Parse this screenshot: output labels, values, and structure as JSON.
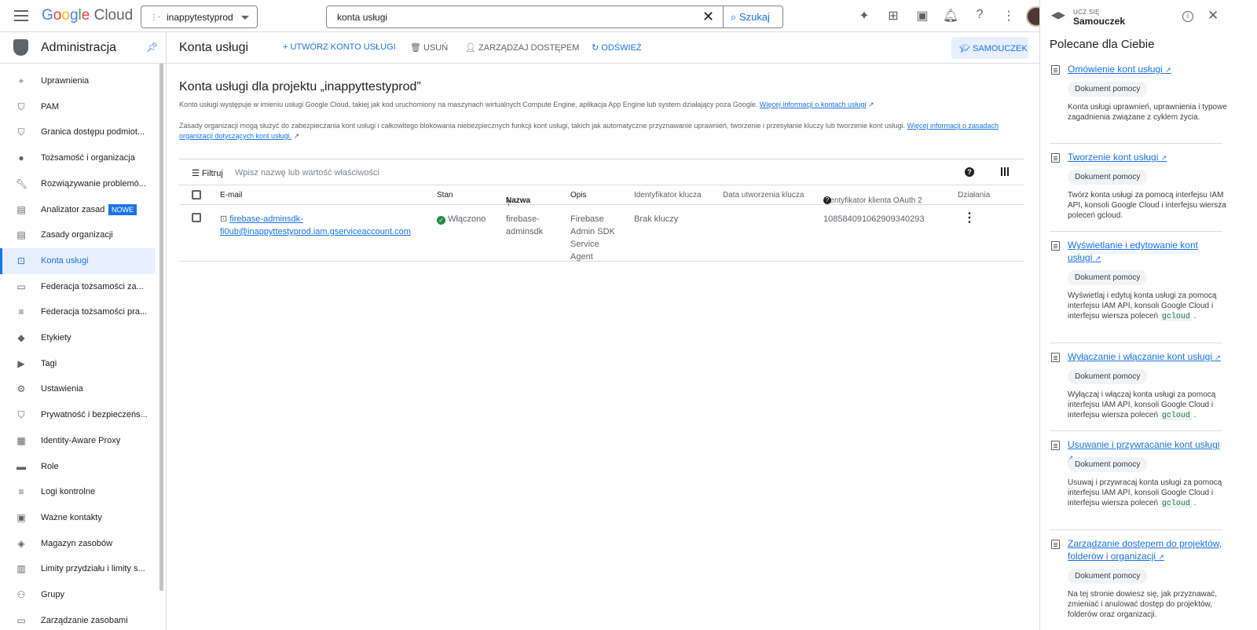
{
  "header": {
    "logo_google": "Google",
    "logo_cloud": "Cloud",
    "project": "inappytestyprod",
    "search_value": "konta usługi",
    "search_button": "Szukaj"
  },
  "nav": {
    "title": "Administracja",
    "items": [
      {
        "label": "Uprawnienia",
        "icon": "add-person-icon"
      },
      {
        "label": "PAM",
        "icon": "shield-icon"
      },
      {
        "label": "Granica dostępu podmiot...",
        "icon": "shield-lock-icon"
      },
      {
        "label": "Tożsamość i organizacja",
        "icon": "account-circle-icon"
      },
      {
        "label": "Rozwiązywanie problemó...",
        "icon": "wrench-icon"
      },
      {
        "label": "Analizator zasad",
        "icon": "policy-icon",
        "badge": "NOWE"
      },
      {
        "label": "Zasady organizacji",
        "icon": "list-alt-icon"
      },
      {
        "label": "Konta usługi",
        "icon": "service-account-icon",
        "active": true
      },
      {
        "label": "Federacja tożsamości za...",
        "icon": "id-card-icon"
      },
      {
        "label": "Federacja tożsamości pra...",
        "icon": "list-icon"
      },
      {
        "label": "Etykiety",
        "icon": "label-icon"
      },
      {
        "label": "Tagi",
        "icon": "tag-icon"
      },
      {
        "label": "Ustawienia",
        "icon": "gear-icon"
      },
      {
        "label": "Prywatność i bezpieczeńs...",
        "icon": "shield-icon"
      },
      {
        "label": "Identity-Aware Proxy",
        "icon": "iap-icon"
      },
      {
        "label": "Role",
        "icon": "hat-icon"
      },
      {
        "label": "Logi kontrolne",
        "icon": "lines-icon"
      },
      {
        "label": "Ważne kontakty",
        "icon": "contacts-icon"
      },
      {
        "label": "Magazyn zasobów",
        "icon": "diamond-icon"
      },
      {
        "label": "Limity przydziału i limity s...",
        "icon": "table-icon"
      },
      {
        "label": "Grupy",
        "icon": "group-icon"
      },
      {
        "label": "Zarządzanie zasobami",
        "icon": "folder-icon"
      }
    ]
  },
  "toolbar": {
    "title": "Konta usługi",
    "create": "UTWÓRZ KONTO USŁUGI",
    "delete": "USUŃ",
    "manage": "ZARZĄDZAJ DOSTĘPEM",
    "refresh": "ODŚWIEŻ",
    "tutorial": "SAMOUCZEK"
  },
  "main": {
    "heading": "Konta usługi dla projektu „inappyttestyprod”",
    "para1": "Konto usługi występuje w imieniu usługi Google Cloud, takiej jak kod uruchomiony na maszynach wirtualnych Compute Engine, aplikacja App Engine lub system działający poza Google.",
    "para1_link": "Więcej informacji o kontach usługi",
    "para2": "Zasady organizacji mogą służyć do zabezpieczania kont usługi i całkowitego blokowania niebezpiecznych funkcji kont usługi, takich jak automatyczne przyznawanie uprawnień, tworzenie i przesyłanie kluczy lub tworzenie kont usługi.",
    "para2_link": "Więcej informacji o zasadach organizacji dotyczących kont usługi.",
    "filter_label": "Filtruj",
    "filter_placeholder": "Wpisz nazwę lub wartość właściwości"
  },
  "table": {
    "columns": [
      "E-mail",
      "Stan",
      "Nazwa",
      "Opis",
      "Identyfikator klucza",
      "Data utworzenia klucza",
      "Identyfikator klienta OAuth 2",
      "Działania"
    ],
    "rows": [
      {
        "email1": "firebase-adminsdk-",
        "email2": "fi0ub@inappyttestyprod.iam.gserviceaccount.com",
        "status": "Włączono",
        "name1": "firebase-",
        "name2": "adminsdk",
        "desc1": "Firebase",
        "desc2": "Admin SDK",
        "desc3": "Service",
        "desc4": "Agent",
        "key_id": "Brak kluczy",
        "key_date": "",
        "oauth_id": "108584091062909340293"
      }
    ]
  },
  "side": {
    "caption": "UCZ SIĘ",
    "title": "Samouczek",
    "heading": "Polecane dla Ciebie",
    "chip": "Dokument pomocy",
    "cards": [
      {
        "title": "Omówienie kont usługi",
        "desc": "Konta usługi uprawnień, uprawnienia i typowe zagadnienia związane z cyklem życia."
      },
      {
        "title": "Tworzenie kont usługi",
        "desc": "Twórz konta usługi za pomocą interfejsu IAM API, konsoli Google Cloud i interfejsu wiersza poleceń gcloud."
      },
      {
        "title": "Wyświetlanie i edytowanie kont usługi",
        "desc": "Wyświetlaj i edytuj konta usługi za pomocą interfejsu IAM API, konsoli Google Cloud i interfejsu wiersza poleceń",
        "code": "gcloud"
      },
      {
        "title": "Wyłączanie i włączanie kont usługi",
        "desc": "Wyłączaj i włączaj konta usługi za pomocą interfejsu IAM API, konsoli Google Cloud i interfejsu wiersza poleceń",
        "code": "gcloud"
      },
      {
        "title": "Usuwanie i przywracanie kont usługi",
        "desc": "Usuwaj i przywracaj konta usługi za pomocą interfejsu IAM API, konsoli Google Cloud i interfejsu wiersza poleceń",
        "code": "gcloud"
      },
      {
        "title": "Zarządzanie dostępem do projektów, folderów i organizacji",
        "desc": "Na tej stronie dowiesz się, jak przyznawać, zmieniać i anulować dostęp do projektów, folderów oraz organizacji."
      }
    ]
  }
}
